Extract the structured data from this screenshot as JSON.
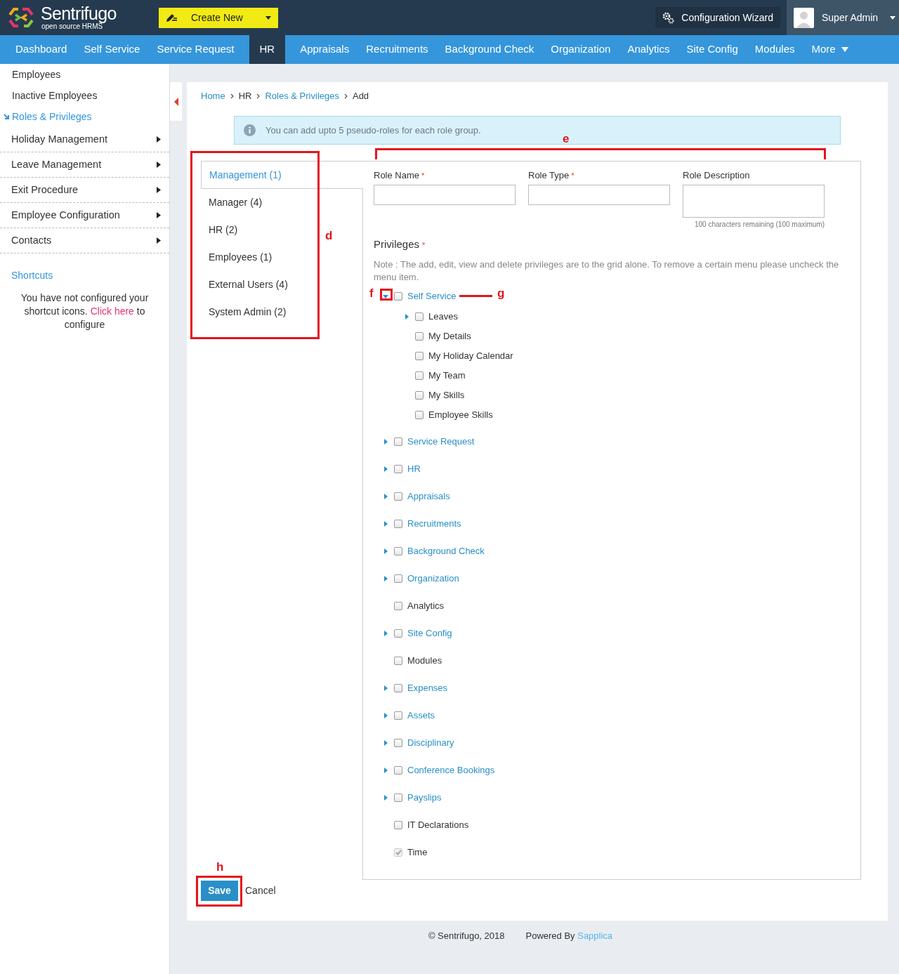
{
  "brand": {
    "name": "Sentrifugo",
    "tagline": "open source HRMS"
  },
  "create_button": {
    "label": "Create New"
  },
  "config_button": {
    "label": "Configuration Wizard"
  },
  "user": {
    "name": "Super Admin"
  },
  "nav": [
    {
      "label": "Dashboard",
      "selected": false,
      "kind": "link"
    },
    {
      "label": "Self Service",
      "selected": false,
      "kind": "link"
    },
    {
      "label": "Service Request",
      "selected": false,
      "kind": "link"
    },
    {
      "label": "HR",
      "selected": true,
      "kind": "link"
    },
    {
      "label": "Appraisals",
      "selected": false,
      "kind": "link"
    },
    {
      "label": "Recruitments",
      "selected": false,
      "kind": "link"
    },
    {
      "label": "Background Check",
      "selected": false,
      "kind": "link"
    },
    {
      "label": "Organization",
      "selected": false,
      "kind": "link"
    },
    {
      "label": "Analytics",
      "selected": false,
      "kind": "link"
    },
    {
      "label": "Site Config",
      "selected": false,
      "kind": "link"
    },
    {
      "label": "Modules",
      "selected": false,
      "kind": "link"
    },
    {
      "label": "More",
      "selected": false,
      "kind": "dropdown"
    }
  ],
  "sidebar": {
    "items": [
      {
        "label": "Employees",
        "kind": "link",
        "selected": false
      },
      {
        "label": "Inactive Employees",
        "kind": "link",
        "selected": false
      },
      {
        "label": "Roles & Privileges",
        "kind": "link",
        "selected": true
      },
      {
        "label": "Holiday Management",
        "kind": "menu",
        "selected": false
      },
      {
        "label": "Leave Management",
        "kind": "menu",
        "selected": false
      },
      {
        "label": "Exit Procedure",
        "kind": "menu",
        "selected": false
      },
      {
        "label": "Employee Configuration",
        "kind": "menu",
        "selected": false
      },
      {
        "label": "Contacts",
        "kind": "menu",
        "selected": false
      }
    ],
    "shortcuts": {
      "title": "Shortcuts",
      "message": "You have not configured your shortcut icons. ",
      "link": "Click here",
      "message_end": " to configure"
    }
  },
  "breadcrumb": [
    {
      "label": "Home",
      "kind": "link"
    },
    {
      "label": "HR",
      "kind": "text"
    },
    {
      "label": "Roles & Privileges",
      "kind": "link"
    },
    {
      "label": "Add",
      "kind": "text"
    }
  ],
  "info": {
    "text": "You can add upto 5 pseudo-roles for each role group."
  },
  "role_groups": [
    {
      "label": "Management (1)",
      "selected": true
    },
    {
      "label": "Manager (4)",
      "selected": false
    },
    {
      "label": "HR (2)",
      "selected": false
    },
    {
      "label": "Employees (1)",
      "selected": false
    },
    {
      "label": "External Users (4)",
      "selected": false
    },
    {
      "label": "System Admin (2)",
      "selected": false
    }
  ],
  "form": {
    "fields": [
      {
        "label": "Role Name",
        "mark": "*",
        "kind": "input"
      },
      {
        "label": "Role Type",
        "mark": "*",
        "kind": "input"
      },
      {
        "label": "Role Description",
        "kind": "textarea",
        "hint": "100 characters remaining (100 maximum)"
      }
    ]
  },
  "privileges": {
    "title": "Privileges",
    "mark": "*",
    "note": "Note : The add, edit, view and delete privileges are to the grid alone. To remove a certain menu please uncheck the menu item.",
    "items": [
      {
        "label": "Self Service",
        "kind": "group",
        "expanded": true,
        "checked": false,
        "disabled": false,
        "children": [
          {
            "label": "Leaves",
            "kind": "group",
            "expanded": false,
            "checked": false,
            "disabled": false
          },
          {
            "label": "My Details",
            "kind": "item",
            "checked": false,
            "disabled": false
          },
          {
            "label": "My Holiday Calendar",
            "kind": "item",
            "checked": false,
            "disabled": false
          },
          {
            "label": "My Team",
            "kind": "item",
            "checked": false,
            "disabled": false
          },
          {
            "label": "My Skills",
            "kind": "item",
            "checked": false,
            "disabled": false
          },
          {
            "label": "Employee Skills",
            "kind": "item",
            "checked": false,
            "disabled": false
          }
        ]
      },
      {
        "label": "Service Request",
        "kind": "group",
        "expanded": false,
        "checked": false,
        "disabled": false
      },
      {
        "label": "HR",
        "kind": "group",
        "expanded": false,
        "checked": false,
        "disabled": false
      },
      {
        "label": "Appraisals",
        "kind": "group",
        "expanded": false,
        "checked": false,
        "disabled": false
      },
      {
        "label": "Recruitments",
        "kind": "group",
        "expanded": false,
        "checked": false,
        "disabled": false
      },
      {
        "label": "Background Check",
        "kind": "group",
        "expanded": false,
        "checked": false,
        "disabled": false
      },
      {
        "label": "Organization",
        "kind": "group",
        "expanded": false,
        "checked": false,
        "disabled": false
      },
      {
        "label": "Analytics",
        "kind": "item",
        "checked": false,
        "disabled": false
      },
      {
        "label": "Site Config",
        "kind": "group",
        "expanded": false,
        "checked": false,
        "disabled": false
      },
      {
        "label": "Modules",
        "kind": "item",
        "checked": false,
        "disabled": false
      },
      {
        "label": "Expenses",
        "kind": "group",
        "expanded": false,
        "checked": false,
        "disabled": false
      },
      {
        "label": "Assets",
        "kind": "group",
        "expanded": false,
        "checked": false,
        "disabled": false
      },
      {
        "label": "Disciplinary",
        "kind": "group",
        "expanded": false,
        "checked": false,
        "disabled": false
      },
      {
        "label": "Conference Bookings",
        "kind": "group",
        "expanded": false,
        "checked": false,
        "disabled": false
      },
      {
        "label": "Payslips",
        "kind": "group",
        "expanded": false,
        "checked": false,
        "disabled": false
      },
      {
        "label": "IT Declarations",
        "kind": "item",
        "checked": false,
        "disabled": false
      },
      {
        "label": "Time",
        "kind": "item",
        "checked": true,
        "disabled": true
      }
    ]
  },
  "buttons": {
    "save": "Save",
    "cancel": "Cancel"
  },
  "footer": {
    "copyright": "© Sentrifugo, 2018",
    "powered_by": "Powered By",
    "powered_link": "Sapplica"
  },
  "annotations": [
    {
      "label": "d"
    },
    {
      "label": "e"
    },
    {
      "label": "f"
    },
    {
      "label": "g"
    },
    {
      "label": "h"
    }
  ]
}
